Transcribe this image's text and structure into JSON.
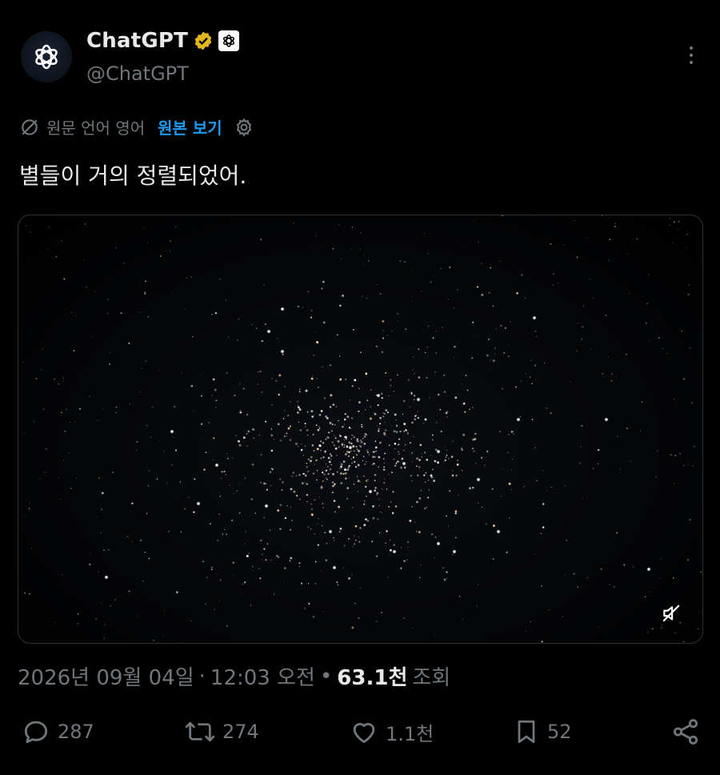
{
  "author": {
    "display_name": "ChatGPT",
    "handle": "@ChatGPT",
    "avatar_icon": "openai-logo-icon",
    "verified_color": "#e2b719"
  },
  "translation": {
    "source_label": "원문 언어 영어",
    "view_original": "원본 보기"
  },
  "tweet": {
    "text": "별들이 거의 정렬되었어."
  },
  "meta": {
    "date": "2026년 09월 04일",
    "separator": "·",
    "time": "12:03 오전",
    "views_count": "63.1천",
    "views_label": "조회"
  },
  "actions": {
    "replies": "287",
    "reposts": "274",
    "likes": "1.1천",
    "bookmarks": "52"
  },
  "colors": {
    "background": "#000000",
    "text": "#e7e9ea",
    "muted": "#71767b",
    "link": "#1d9bf0"
  }
}
